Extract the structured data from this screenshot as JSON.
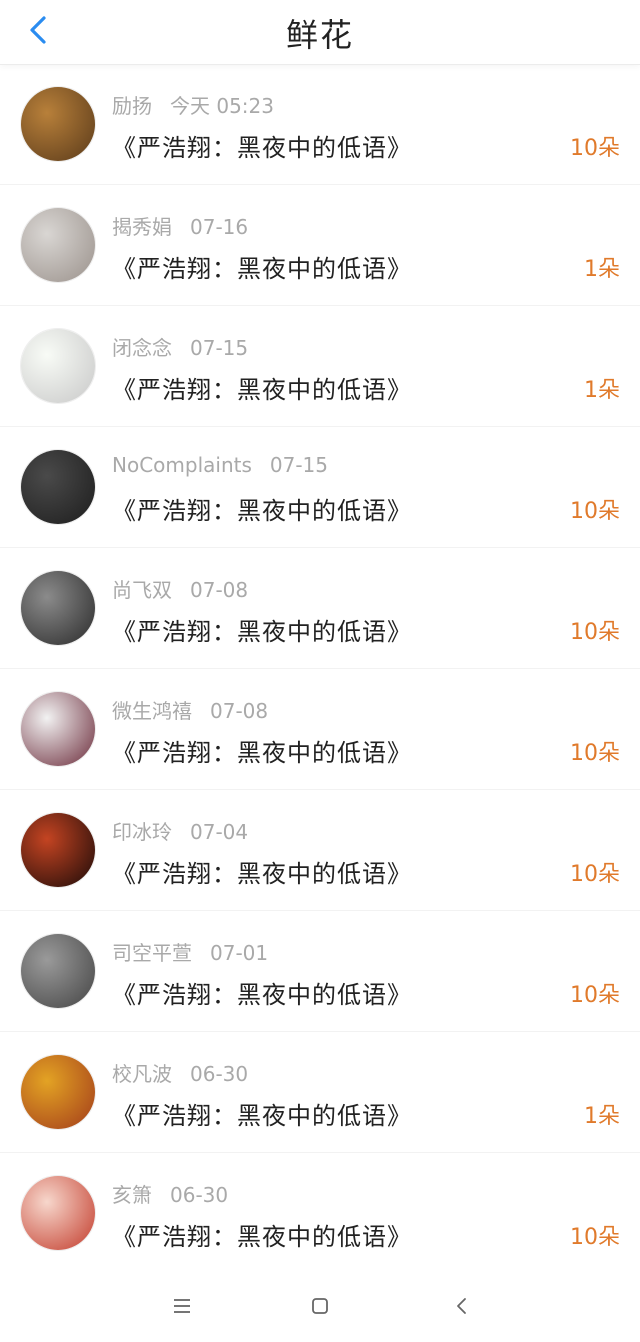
{
  "header": {
    "title": "鲜花"
  },
  "items": [
    {
      "name": "励扬",
      "date": "今天 05:23",
      "book": "《严浩翔：黑夜中的低语》",
      "count": "10朵",
      "avatar_colors": [
        "#b8803a",
        "#5a3a1a"
      ]
    },
    {
      "name": "揭秀娟",
      "date": "07-16",
      "book": "《严浩翔：黑夜中的低语》",
      "count": "1朵",
      "avatar_colors": [
        "#d9d6d3",
        "#9a918b"
      ]
    },
    {
      "name": "闭念念",
      "date": "07-15",
      "book": "《严浩翔：黑夜中的低语》",
      "count": "1朵",
      "avatar_colors": [
        "#f8fbf6",
        "#c8c8c8"
      ]
    },
    {
      "name": "NoComplaints",
      "date": "07-15",
      "book": "《严浩翔：黑夜中的低语》",
      "count": "10朵",
      "avatar_colors": [
        "#4a4a4a",
        "#1d1d1d"
      ]
    },
    {
      "name": "尚飞双",
      "date": "07-08",
      "book": "《严浩翔：黑夜中的低语》",
      "count": "10朵",
      "avatar_colors": [
        "#8b8b8b",
        "#2a2a2a"
      ]
    },
    {
      "name": "微生鸿禧",
      "date": "07-08",
      "book": "《严浩翔：黑夜中的低语》",
      "count": "10朵",
      "avatar_colors": [
        "#f2f2f2",
        "#6b2b3a"
      ]
    },
    {
      "name": "印冰玲",
      "date": "07-04",
      "book": "《严浩翔：黑夜中的低语》",
      "count": "10朵",
      "avatar_colors": [
        "#c44422",
        "#1a0a08"
      ]
    },
    {
      "name": "司空平萱",
      "date": "07-01",
      "book": "《严浩翔：黑夜中的低语》",
      "count": "10朵",
      "avatar_colors": [
        "#9a9a9a",
        "#444444"
      ]
    },
    {
      "name": "校凡波",
      "date": "06-30",
      "book": "《严浩翔：黑夜中的低语》",
      "count": "1朵",
      "avatar_colors": [
        "#e3a324",
        "#a23b1a"
      ]
    },
    {
      "name": "亥箫",
      "date": "06-30",
      "book": "《严浩翔：黑夜中的低语》",
      "count": "10朵",
      "avatar_colors": [
        "#f7d7cc",
        "#c23a2a"
      ]
    }
  ],
  "colors": {
    "accent": "#2a8cf0",
    "count": "#e07a2b",
    "muted": "#a9a9a9"
  }
}
